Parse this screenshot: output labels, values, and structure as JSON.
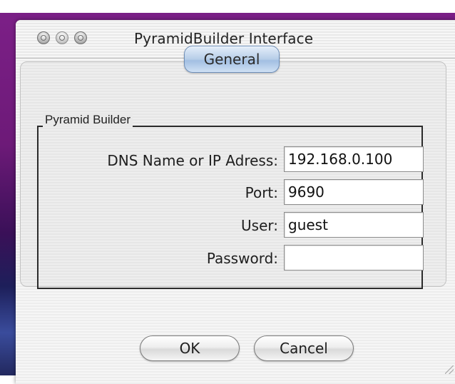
{
  "window": {
    "title": "PyramidBuilder Interface"
  },
  "tabs": [
    {
      "label": "General",
      "selected": true
    }
  ],
  "group": {
    "title": "Pyramid Builder"
  },
  "form": {
    "dns": {
      "label": "DNS Name or IP Adress:",
      "value": "192.168.0.100"
    },
    "port": {
      "label": "Port:",
      "value": "9690"
    },
    "user": {
      "label": "User:",
      "value": "guest"
    },
    "password": {
      "label": "Password:",
      "value": ""
    }
  },
  "buttons": {
    "ok": "OK",
    "cancel": "Cancel"
  },
  "colors": {
    "desktop_accent": "#7a1f86",
    "tab_selected": "#a2bfe2"
  }
}
